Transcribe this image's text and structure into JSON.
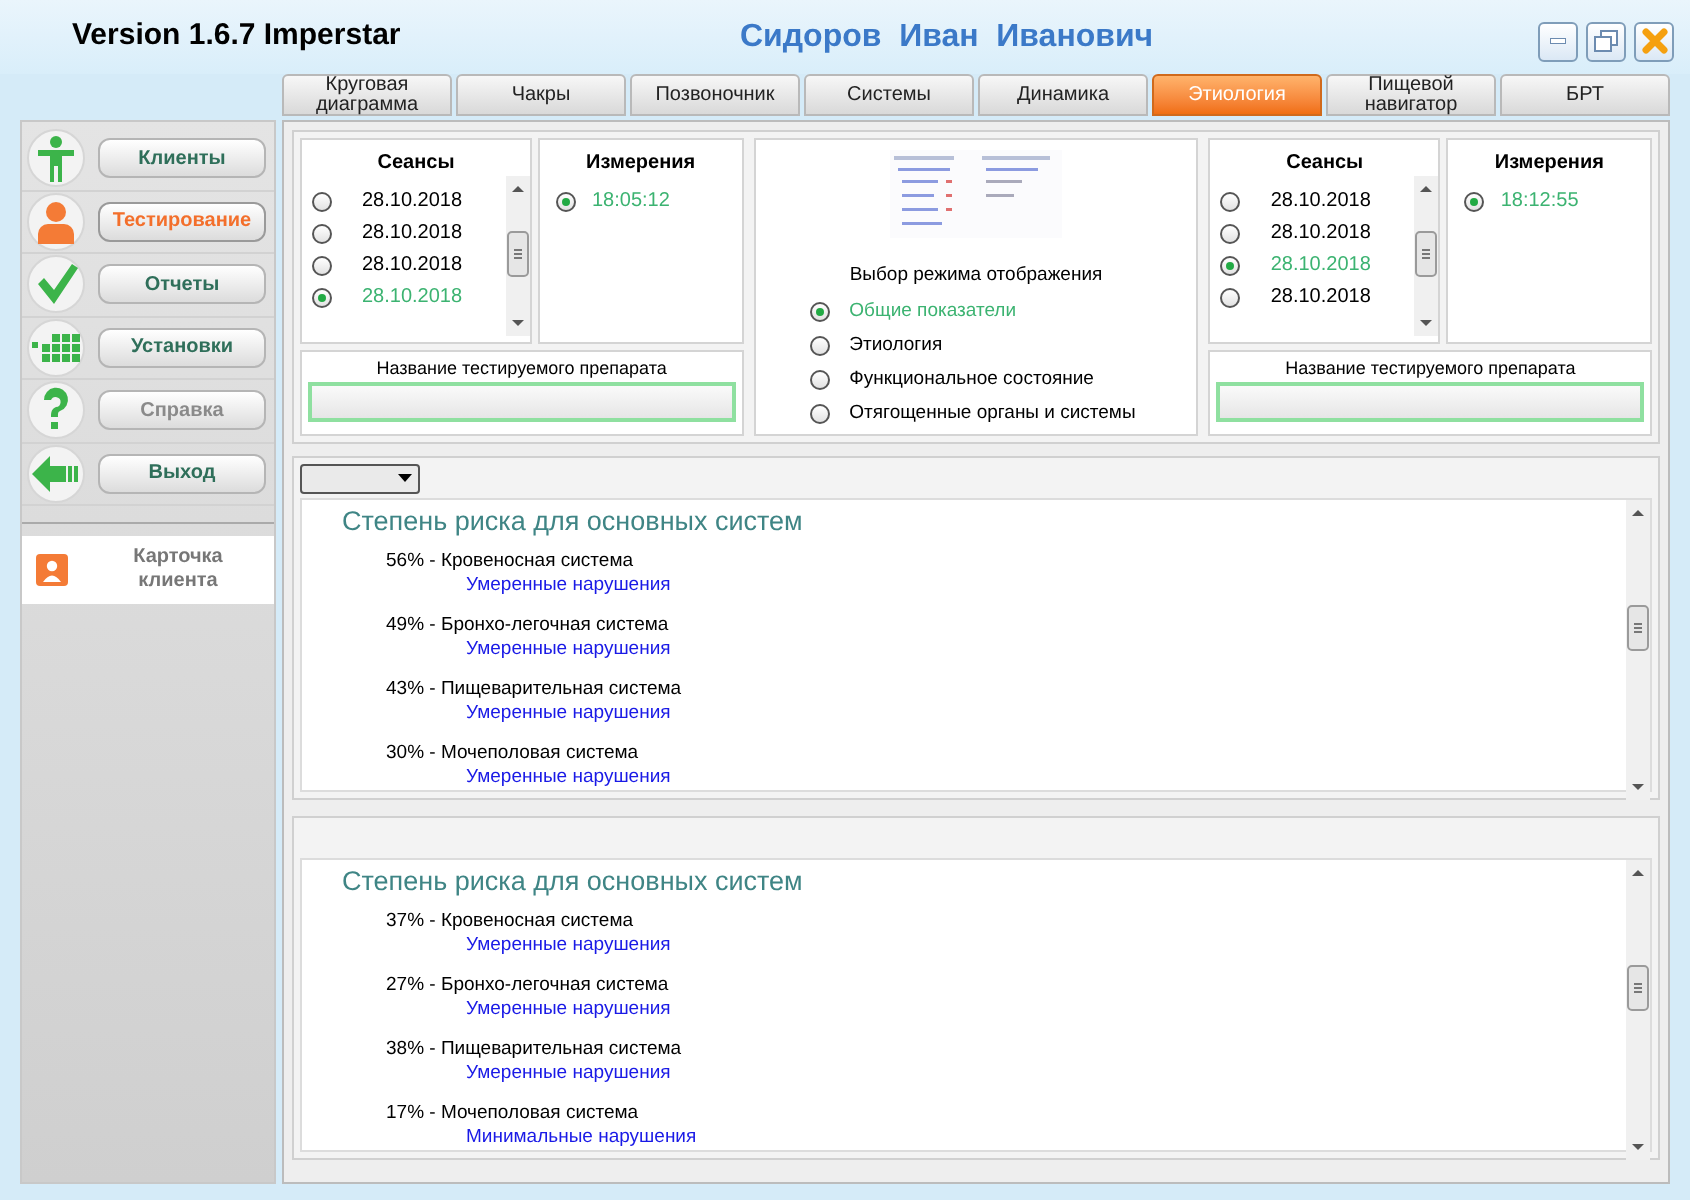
{
  "window": {
    "version": "Version 1.6.7 Imperstar",
    "title": "Сидоров  Иван  Иванович"
  },
  "tabs": [
    {
      "label": "Круговая диаграмма",
      "selected": false
    },
    {
      "label": "Чакры",
      "selected": false
    },
    {
      "label": "Позвоночник",
      "selected": false
    },
    {
      "label": "Системы",
      "selected": false
    },
    {
      "label": "Динамика",
      "selected": false
    },
    {
      "label": "Этиология",
      "selected": true
    },
    {
      "label": "Пищевой навигатор",
      "selected": false
    },
    {
      "label": "БРТ",
      "selected": false
    }
  ],
  "sidebar": {
    "items": [
      {
        "kind": "clients",
        "label": "Клиенты",
        "selected": false,
        "disabled": false
      },
      {
        "kind": "testing",
        "label": "Тестирование",
        "selected": true,
        "disabled": false
      },
      {
        "kind": "reports",
        "label": "Отчеты",
        "selected": false,
        "disabled": false
      },
      {
        "kind": "settings",
        "label": "Установки",
        "selected": false,
        "disabled": false
      },
      {
        "kind": "help",
        "label": "Справка",
        "selected": false,
        "disabled": true
      },
      {
        "kind": "exit",
        "label": "Выход",
        "selected": false,
        "disabled": false
      }
    ],
    "card": {
      "label": "Карточка клиента"
    }
  },
  "session_panels": [
    {
      "sessions": {
        "title": "Сеансы",
        "items": [
          {
            "date": "28.10.2018",
            "selected": false
          },
          {
            "date": "28.10.2018",
            "selected": false
          },
          {
            "date": "28.10.2018",
            "selected": false
          },
          {
            "date": "28.10.2018",
            "selected": true
          }
        ]
      },
      "measurements": {
        "title": "Измерения",
        "items": [
          {
            "time": "18:05:12",
            "selected": true
          }
        ]
      },
      "drug": {
        "label": "Название тестируемого препарата"
      }
    },
    {
      "sessions": {
        "title": "Сеансы",
        "items": [
          {
            "date": "28.10.2018",
            "selected": false
          },
          {
            "date": "28.10.2018",
            "selected": false
          },
          {
            "date": "28.10.2018",
            "selected": true
          },
          {
            "date": "28.10.2018",
            "selected": false
          }
        ]
      },
      "measurements": {
        "title": "Измерения",
        "items": [
          {
            "time": "18:12:55",
            "selected": true
          }
        ]
      },
      "drug": {
        "label": "Название тестируемого препарата"
      }
    }
  ],
  "display_mode": {
    "title": "Выбор режима отображения",
    "options": [
      {
        "label": "Общие показатели",
        "selected": true
      },
      {
        "label": "Этиология",
        "selected": false
      },
      {
        "label": "Функциональное состояние",
        "selected": false
      },
      {
        "label": "Отягощенные органы и системы",
        "selected": false
      }
    ]
  },
  "reports": [
    {
      "has_dropdown": true,
      "title": "Степень риска для основных систем",
      "items": [
        {
          "line": "56% - Кровеносная система",
          "assessment": "Умеренные нарушения"
        },
        {
          "line": "49% - Бронхо-легочная система",
          "assessment": "Умеренные нарушения"
        },
        {
          "line": "43% - Пищеварительная система",
          "assessment": "Умеренные нарушения"
        },
        {
          "line": "30% - Мочеполовая система",
          "assessment": "Умеренные нарушения"
        }
      ]
    },
    {
      "has_dropdown": false,
      "title": "Степень риска для основных систем",
      "items": [
        {
          "line": "37% - Кровеносная система",
          "assessment": "Умеренные нарушения"
        },
        {
          "line": "27% - Бронхо-легочная система",
          "assessment": "Умеренные нарушения"
        },
        {
          "line": "38% - Пищеварительная система",
          "assessment": "Умеренные нарушения"
        },
        {
          "line": "17% - Мочеполовая система",
          "assessment": "Минимальные нарушения"
        }
      ]
    }
  ]
}
